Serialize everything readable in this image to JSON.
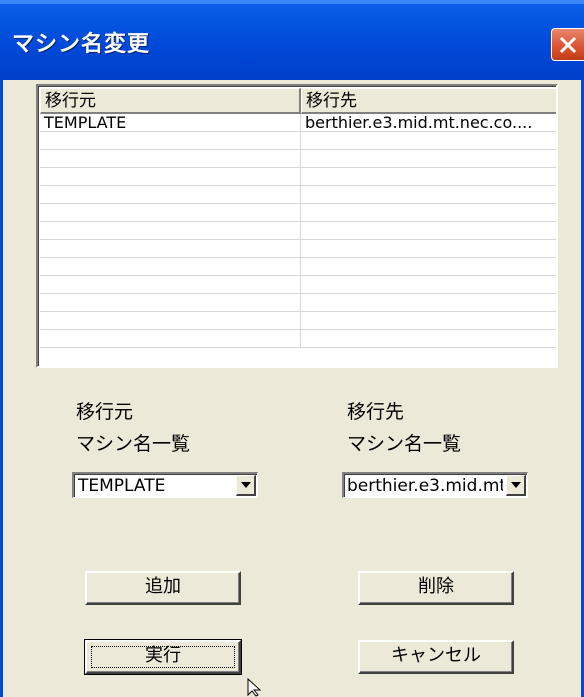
{
  "window": {
    "title": "マシン名変更"
  },
  "list": {
    "headers": [
      "移行元",
      "移行先"
    ],
    "rows": [
      [
        "TEMPLATE",
        "berthier.e3.mid.mt.nec.co...."
      ],
      [
        "",
        ""
      ],
      [
        "",
        ""
      ],
      [
        "",
        ""
      ],
      [
        "",
        ""
      ],
      [
        "",
        ""
      ],
      [
        "",
        ""
      ],
      [
        "",
        ""
      ],
      [
        "",
        ""
      ],
      [
        "",
        ""
      ],
      [
        "",
        ""
      ],
      [
        "",
        ""
      ],
      [
        "",
        ""
      ]
    ]
  },
  "source": {
    "label1": "移行元",
    "label2": "マシン名一覧",
    "selected": "TEMPLATE"
  },
  "target": {
    "label1": "移行先",
    "label2": "マシン名一覧",
    "selected": "berthier.e3.mid.mt"
  },
  "buttons": {
    "add": "追加",
    "delete": "削除",
    "execute": "実行",
    "cancel": "キャンセル"
  }
}
